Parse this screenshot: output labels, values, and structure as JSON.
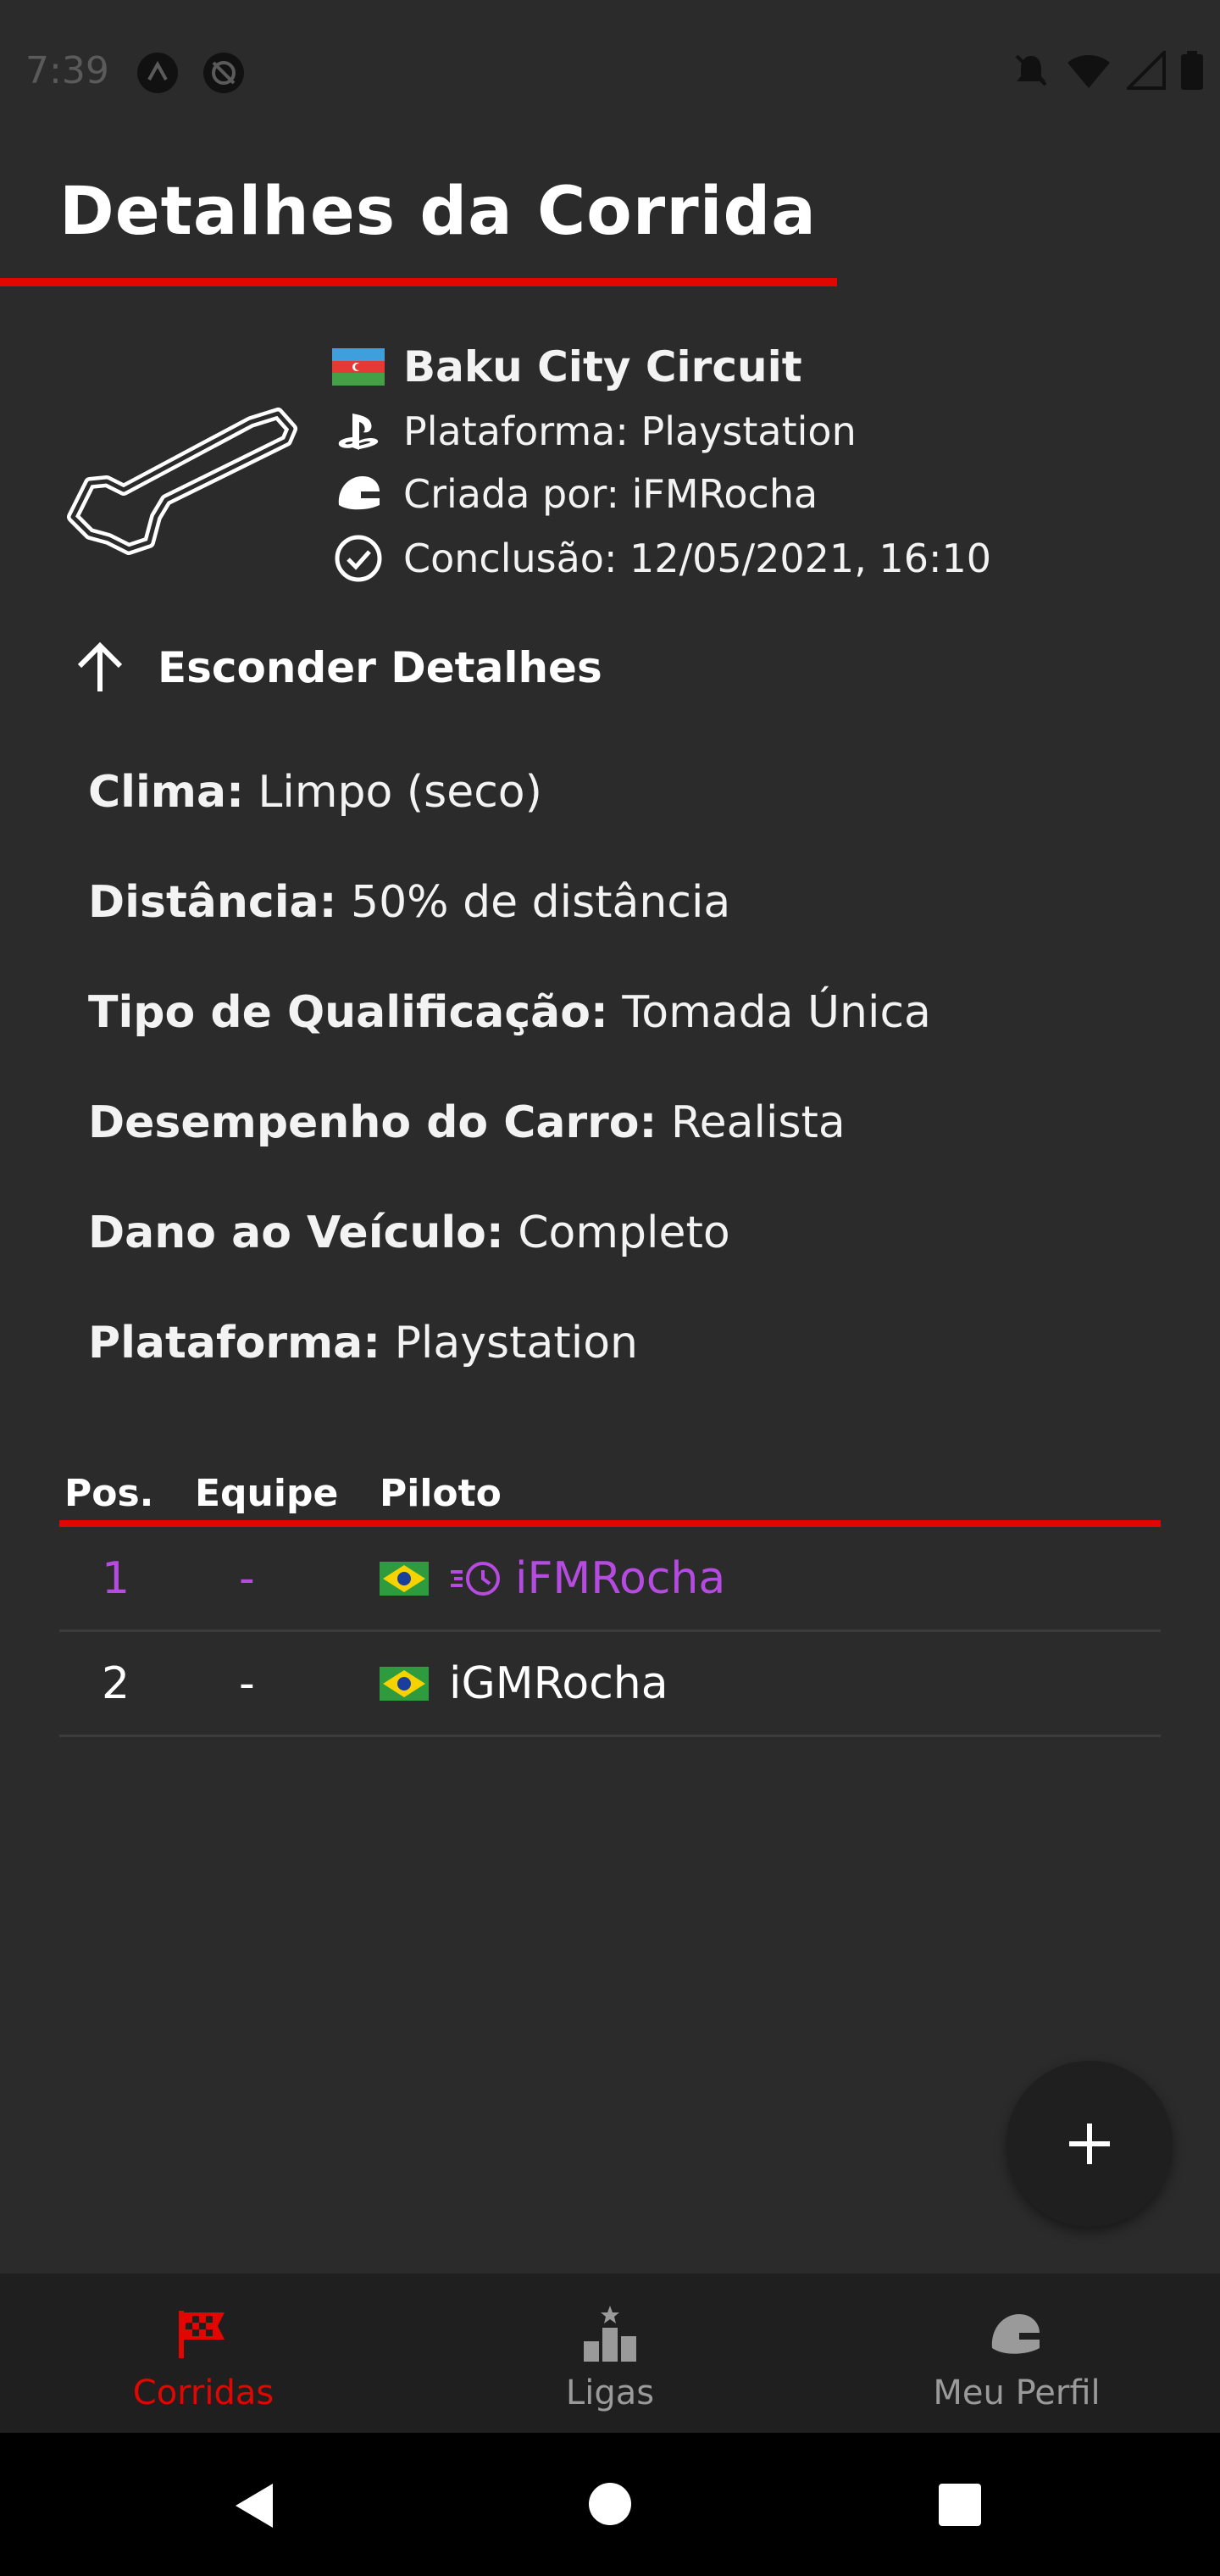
{
  "status_bar": {
    "time": "7:39"
  },
  "page": {
    "title": "Detalhes da Corrida"
  },
  "race": {
    "circuit": "Baku City Circuit",
    "platform": "Plataforma: Playstation",
    "creator": "Criada por: iFMRocha",
    "completion": "Conclusão: 12/05/2021, 16:10"
  },
  "toggle_label": "Esconder Detalhes",
  "details": [
    {
      "label": "Clima:",
      "value": "Limpo (seco)"
    },
    {
      "label": "Distância:",
      "value": "50% de distância"
    },
    {
      "label": "Tipo de Qualificação:",
      "value": "Tomada Única"
    },
    {
      "label": "Desempenho do Carro:",
      "value": "Realista"
    },
    {
      "label": "Dano ao Veículo:",
      "value": "Completo"
    },
    {
      "label": "Plataforma:",
      "value": "Playstation"
    }
  ],
  "results": {
    "headers": {
      "pos": "Pos.",
      "team": "Equipe",
      "driver": "Piloto"
    },
    "rows": [
      {
        "pos": "1",
        "team": "-",
        "driver": "iFMRocha",
        "fastest_lap": true
      },
      {
        "pos": "2",
        "team": "-",
        "driver": "iGMRocha",
        "fastest_lap": false
      }
    ]
  },
  "bottom_nav": {
    "items": [
      {
        "label": "Corridas",
        "icon": "checkered-flag-icon",
        "active": true
      },
      {
        "label": "Ligas",
        "icon": "podium-icon",
        "active": false
      },
      {
        "label": "Meu Perfil",
        "icon": "helmet-icon",
        "active": false
      }
    ]
  },
  "colors": {
    "accent": "#e10600",
    "fastest": "#b54be0",
    "background": "#2b2b2b"
  }
}
